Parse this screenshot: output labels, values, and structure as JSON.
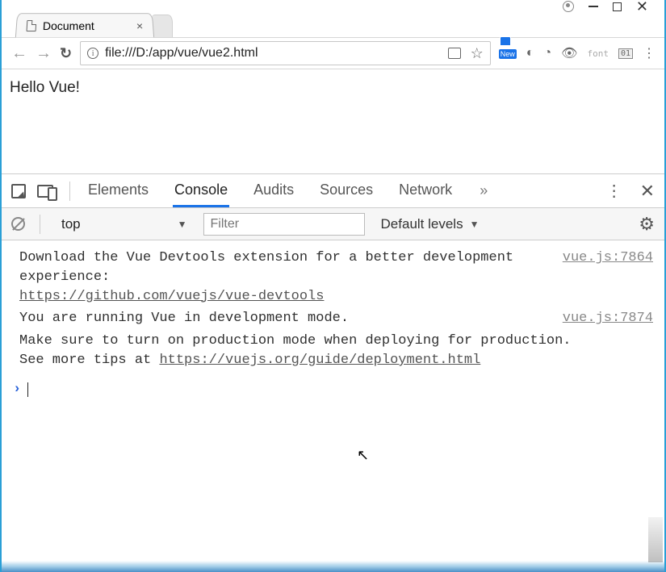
{
  "window": {
    "user_icon": "user-circle"
  },
  "tab": {
    "title": "Document"
  },
  "addressbar": {
    "url": "file:///D:/app/vue/vue2.html"
  },
  "ext": {
    "new_label": "New",
    "font_label": "font",
    "zero_one": "01"
  },
  "page": {
    "content": "Hello Vue!"
  },
  "devtools": {
    "tabs": {
      "elements": "Elements",
      "console": "Console",
      "audits": "Audits",
      "sources": "Sources",
      "network": "Network"
    }
  },
  "console_filter": {
    "context": "top",
    "filter_placeholder": "Filter",
    "levels": "Default levels"
  },
  "console": {
    "msg1": {
      "text_a": "Download the Vue Devtools extension for a better development experience:",
      "link": "https://github.com/vuejs/vue-devtools",
      "src": "vue.js:7864"
    },
    "msg2": {
      "line1": "You are running Vue in development mode.",
      "line2": "Make sure to turn on production mode when deploying for production.",
      "line3a": "See more tips at ",
      "link": "https://vuejs.org/guide/deployment.html",
      "src": "vue.js:7874"
    }
  }
}
